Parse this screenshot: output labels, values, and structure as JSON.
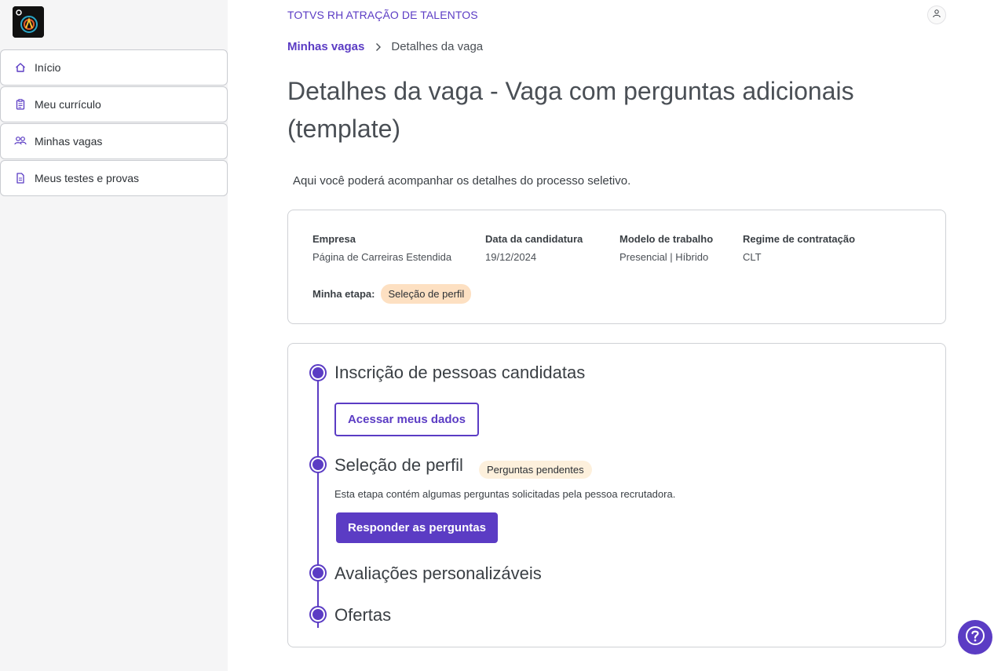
{
  "header": {
    "brand": "TOTVS RH ATRAÇÃO DE TALENTOS",
    "avatar_icon": "user-icon"
  },
  "sidebar": {
    "logo_icon": "app-logo",
    "items": [
      {
        "label": "Início",
        "icon": "home-icon"
      },
      {
        "label": "Meu currículo",
        "icon": "clipboard-icon"
      },
      {
        "label": "Minhas vagas",
        "icon": "users-icon"
      },
      {
        "label": "Meus testes e provas",
        "icon": "document-icon"
      }
    ]
  },
  "breadcrumb": {
    "parent": "Minhas vagas",
    "current": "Detalhes da vaga"
  },
  "page": {
    "title": "Detalhes da vaga - Vaga com perguntas adicionais (template)",
    "subtitle": "Aqui você poderá acompanhar os detalhes do processo seletivo."
  },
  "info": {
    "fields": [
      {
        "label": "Empresa",
        "value": "Página de Carreiras Estendida"
      },
      {
        "label": "Data da candidatura",
        "value": "19/12/2024"
      },
      {
        "label": "Modelo de trabalho",
        "value": "Presencial | Híbrido"
      },
      {
        "label": "Regime de contratação",
        "value": "CLT"
      }
    ],
    "stage_label": "Minha etapa:",
    "stage_value": "Seleção de perfil"
  },
  "timeline": {
    "steps": [
      {
        "title": "Inscrição de pessoas candidatas",
        "button": "Acessar meus dados"
      },
      {
        "title": "Seleção de perfil",
        "badge": "Perguntas pendentes",
        "description": "Esta etapa contém algumas perguntas solicitadas pela pessoa recrutadora.",
        "button": "Responder as perguntas"
      },
      {
        "title": "Avaliações personalizáveis"
      },
      {
        "title": "Ofertas"
      }
    ]
  },
  "help": {
    "icon": "help-icon"
  },
  "colors": {
    "accent": "#5b3cc4",
    "stage_badge_bg": "#fde0c2",
    "pending_badge_bg": "#fdf0dc"
  }
}
